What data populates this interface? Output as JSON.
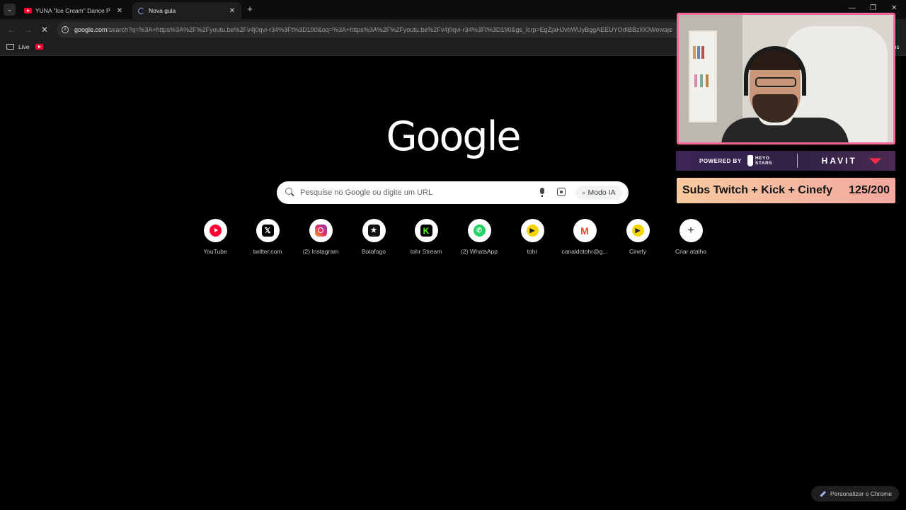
{
  "tabs": [
    {
      "title": "YUNA \"Ice Cream\" Dance P",
      "favicon": "youtube-icon",
      "active": false
    },
    {
      "title": "Nova guia",
      "favicon": "loading-spinner-icon",
      "active": true
    }
  ],
  "toolbar": {
    "url_host": "google.com",
    "url_path": "/search?q=%3A+https%3A%2F%2Fyoutu.be%2Fv4j0qvi-r34%3Ft%3D190&oq=%3A+https%3A%2F%2Fyoutu.be%2Fv4j0qvi-r34%3Ft%3D190&gs_lcrp=EgZjaHJvbWUyBggAEEUYOdIBBzI0OWowaje"
  },
  "bookmarks": {
    "items": [
      {
        "label": "Live"
      }
    ],
    "overflow_label": "os"
  },
  "logo": "Google",
  "search": {
    "placeholder": "Pesquise no Google ou digite um URL",
    "ai_mode_label": "Modo IA"
  },
  "shortcuts": [
    {
      "label": "YouTube",
      "icon": "youtube-icon"
    },
    {
      "label": "twitter.com",
      "icon": "x-icon"
    },
    {
      "label": "(2) Instagram",
      "icon": "instagram-icon"
    },
    {
      "label": "Botafogo",
      "icon": "star-icon"
    },
    {
      "label": "tohr Stream",
      "icon": "kick-icon"
    },
    {
      "label": "(2) WhatsApp",
      "icon": "whatsapp-icon"
    },
    {
      "label": "tohr",
      "icon": "cinefy-icon"
    },
    {
      "label": "canaldotohr@g...",
      "icon": "gmail-icon"
    },
    {
      "label": "Cinefy",
      "icon": "cinefy-icon"
    },
    {
      "label": "Criar atalho",
      "icon": "plus-icon"
    }
  ],
  "customize_label": "Personalizar o Chrome",
  "overlay": {
    "sponsor_powered": "POWERED BY",
    "sponsor_heyo": "HEYO STARS",
    "sponsor_havit": "HAVIT",
    "subs_goal_label": "Subs Twitch + Kick + Cinefy",
    "subs_goal_count": "125/200",
    "frame_color": "#f06a9a"
  }
}
